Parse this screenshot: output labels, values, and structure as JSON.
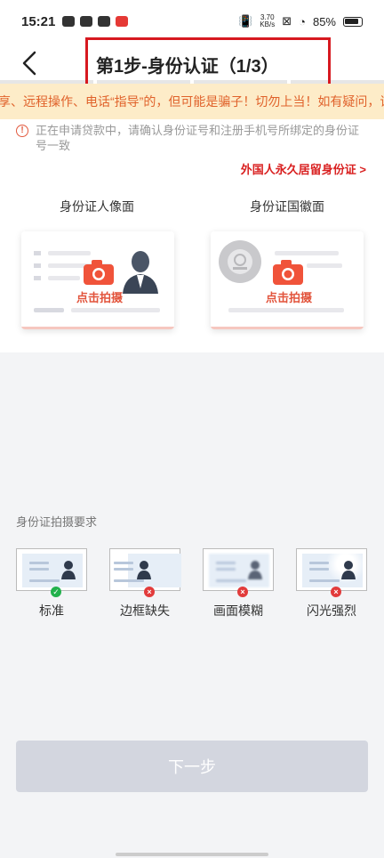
{
  "status": {
    "time": "15:21",
    "net_speed_value": "3.70",
    "net_speed_unit": "KB/s",
    "battery": "85%"
  },
  "nav": {
    "title": "第1步-身份认证（1/3）"
  },
  "marquee": {
    "text": "享、远程操作、电话“指导”的，但可能是骗子！切勿上当！如有疑问，请"
  },
  "notice": {
    "icon": "!",
    "text": "正在申请贷款中，请确认身份证号和注册手机号所绑定的身份证号一致"
  },
  "id_section": {
    "foreign_link": "外国人永久居留身份证 >",
    "front": {
      "label": "身份证人像面",
      "action": "点击拍摄"
    },
    "back": {
      "label": "身份证国徽面",
      "action": "点击拍摄"
    }
  },
  "requirements": {
    "title": "身份证拍摄要求",
    "items": [
      {
        "label": "标准",
        "status": "ok",
        "badge": "✓"
      },
      {
        "label": "边框缺失",
        "status": "bad",
        "badge": "×"
      },
      {
        "label": "画面模糊",
        "status": "bad",
        "badge": "×"
      },
      {
        "label": "闪光强烈",
        "status": "bad",
        "badge": "×"
      }
    ]
  },
  "footer": {
    "next_label": "下一步"
  },
  "colors": {
    "accent_red": "#d92121",
    "marquee_bg": "#fdecc8",
    "button_disabled": "#d3d6df"
  }
}
